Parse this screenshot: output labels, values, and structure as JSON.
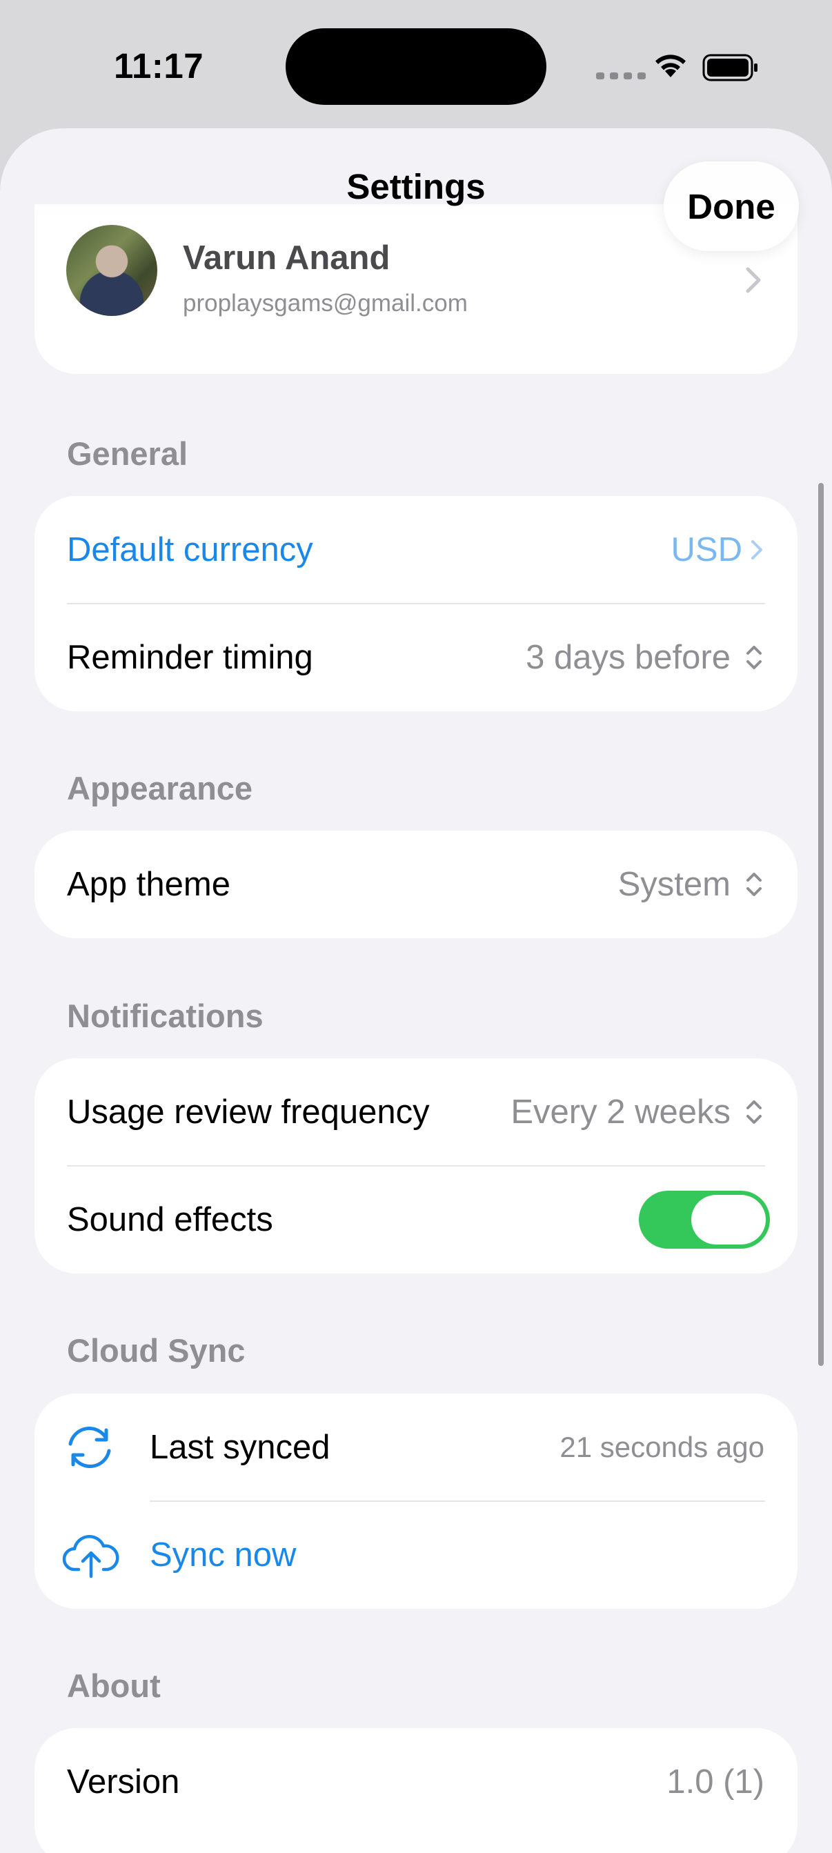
{
  "status_bar": {
    "time": "11:17"
  },
  "header": {
    "title": "Settings",
    "done_label": "Done"
  },
  "profile": {
    "name": "Varun Anand",
    "email": "proplaysgams@gmail.com"
  },
  "sections": {
    "general": {
      "title": "General",
      "default_currency": {
        "label": "Default currency",
        "value": "USD"
      },
      "reminder_timing": {
        "label": "Reminder timing",
        "value": "3 days before"
      }
    },
    "appearance": {
      "title": "Appearance",
      "app_theme": {
        "label": "App theme",
        "value": "System"
      }
    },
    "notifications": {
      "title": "Notifications",
      "usage_review": {
        "label": "Usage review frequency",
        "value": "Every 2 weeks"
      },
      "sound_effects": {
        "label": "Sound effects",
        "enabled": true
      }
    },
    "cloud_sync": {
      "title": "Cloud Sync",
      "last_synced": {
        "label": "Last synced",
        "value": "21 seconds ago"
      },
      "sync_now": {
        "label": "Sync now"
      }
    },
    "about": {
      "title": "About",
      "version": {
        "label": "Version",
        "value": "1.0 (1)"
      }
    }
  },
  "colors": {
    "accent_blue": "#1a88e8",
    "toggle_on": "#34c759",
    "secondary_text": "#8e8e93",
    "background": "#f2f2f7"
  }
}
